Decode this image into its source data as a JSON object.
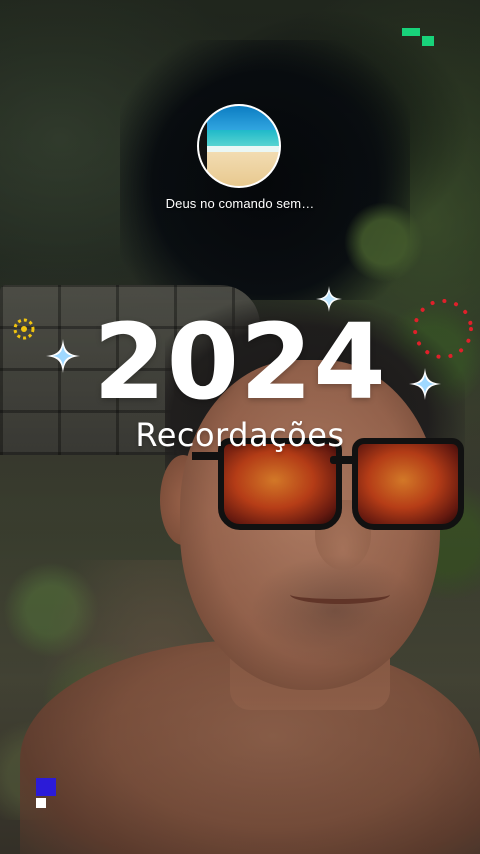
{
  "story": {
    "avatar_alt": "beach-photo",
    "caption": "Deus no comando sem…"
  },
  "recap": {
    "year": "2024",
    "subtitle": "Recordações"
  },
  "colors": {
    "text": "#ffffff",
    "deco_green": "#18d27a",
    "deco_blue": "#2b1bd8",
    "deco_red": "#e0202a",
    "deco_yellow": "#f1c40f",
    "sparkle_blue": "#9fd8ff"
  },
  "icons": {
    "sparkle": "four-point-star",
    "flower": "dotted-circle",
    "pixel": "square-blocks"
  }
}
